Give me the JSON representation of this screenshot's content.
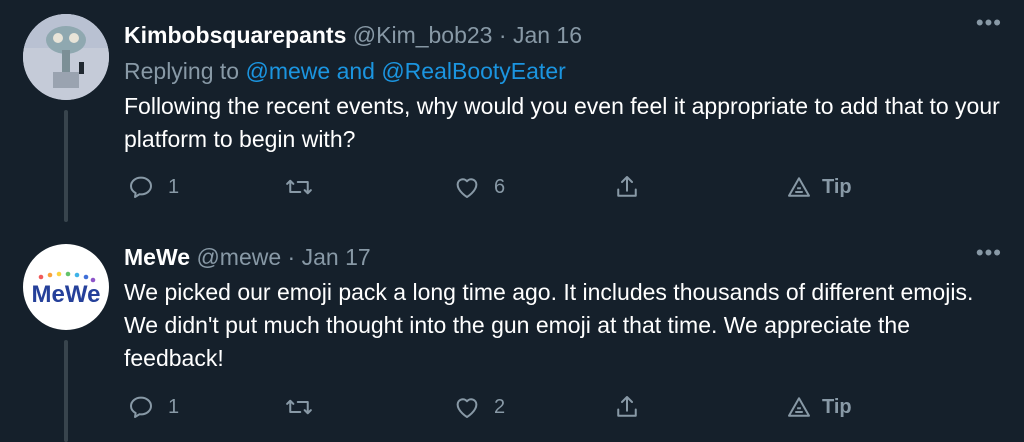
{
  "tweets": [
    {
      "display_name": "Kimbobsquarepants",
      "handle": "@Kim_bob23",
      "separator": "·",
      "date": "Jan 16",
      "replying_prefix": "Replying to",
      "replying_mention_1": "@mewe",
      "replying_and": "and",
      "replying_mention_2": "@RealBootyEater",
      "text": "Following the recent events, why would you even feel it appropriate to add that to your platform to begin with?",
      "more": "•••",
      "reply_count": "1",
      "retweet_count": "",
      "like_count": "6",
      "tip_label": "Tip"
    },
    {
      "display_name": "MeWe",
      "handle": "@mewe",
      "separator": "·",
      "date": "Jan 17",
      "text": "We picked our emoji pack a long time ago. It includes thousands of different emojis. We didn't put much thought into the gun emoji at that time. We appreciate the feedback!",
      "more": "•••",
      "avatar_logo": "MeWe",
      "reply_count": "1",
      "retweet_count": "",
      "like_count": "2",
      "tip_label": "Tip"
    }
  ],
  "colors": {
    "background": "#15202b",
    "secondary_text": "#8899a6",
    "link": "#1b95e0",
    "thread_line": "#38444d"
  },
  "icons": [
    "reply-icon",
    "retweet-icon",
    "like-icon",
    "share-icon",
    "tip-icon",
    "more-icon"
  ]
}
